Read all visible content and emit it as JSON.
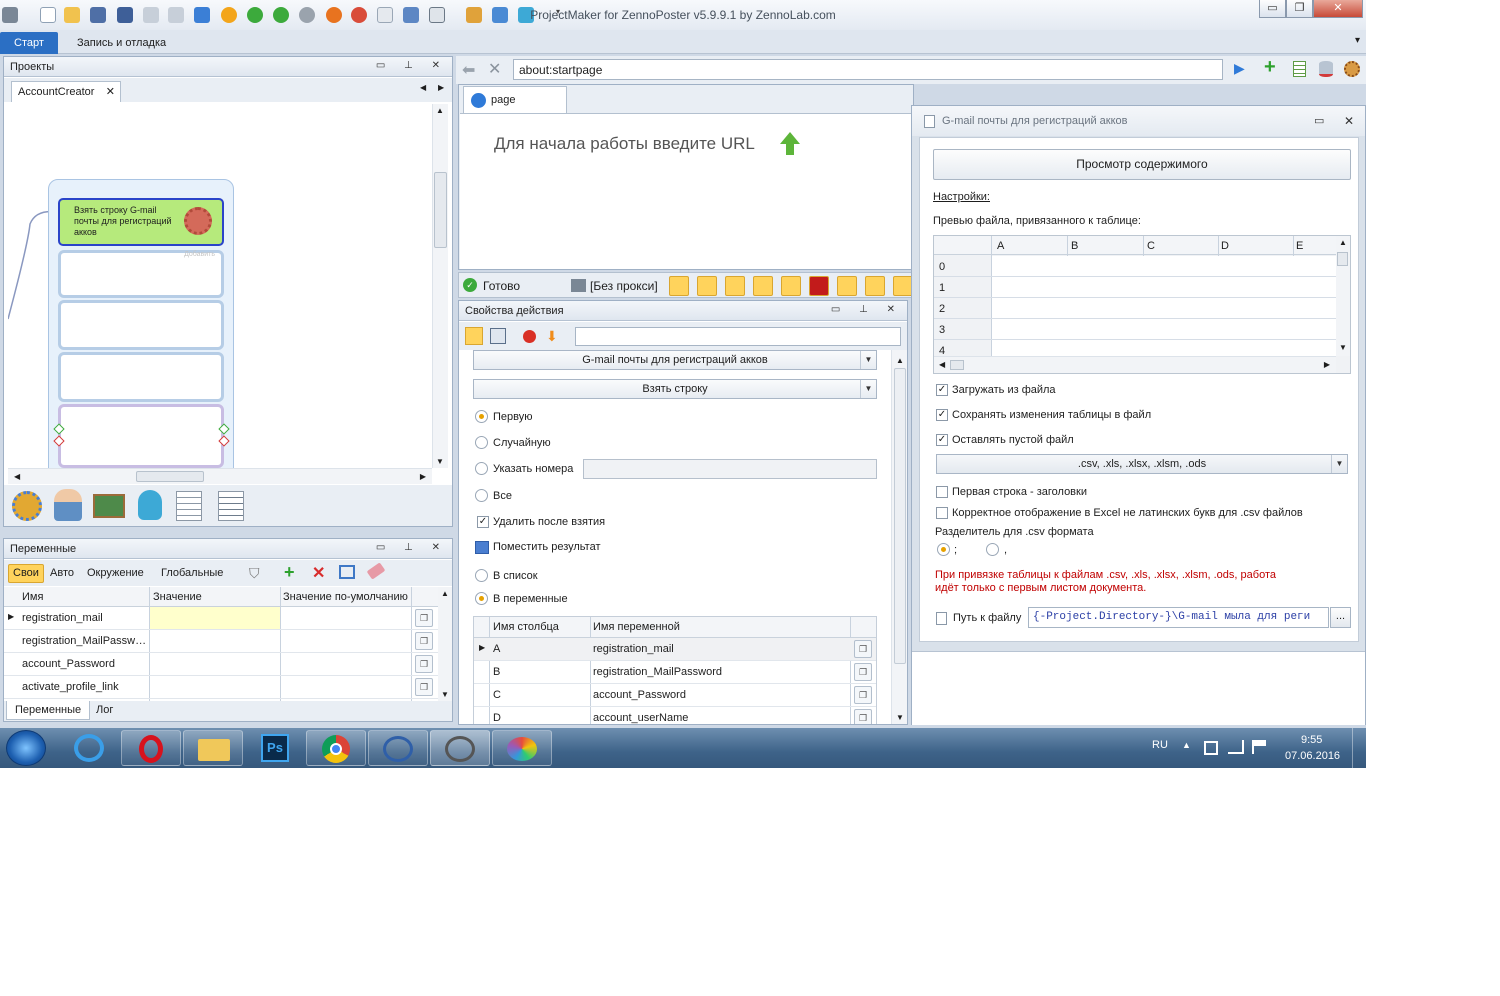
{
  "titlebar": {
    "title": "ProjectMaker for ZennoPoster v5.9.9.1 by ZennoLab.com",
    "min_icon": "minimize-icon",
    "max_icon": "maximize-icon",
    "close_icon": "close-icon"
  },
  "ribbon": {
    "tabs": [
      "Старт",
      "Запись и отладка"
    ]
  },
  "projects": {
    "title": "Проекты",
    "tab_label": "AccountCreator",
    "node_label": "Взять строку G-mail почты для регистраций акков",
    "node_small_text": "Добавить"
  },
  "browser": {
    "url": "about:startpage",
    "page_tab": "page",
    "start_hint": "Для начала работы введите URL",
    "status_ready": "Готово",
    "status_proxy": "[Без прокси]"
  },
  "props": {
    "title": "Свойства действия",
    "table_combo": "G-mail почты для регистраций акков",
    "action_combo": "Взять строку",
    "radio_first": "Первую",
    "radio_random": "Случайную",
    "radio_numbers": "Указать номера",
    "radio_all": "Все",
    "chk_delete": "Удалить после взятия",
    "put_result": "Поместить результат",
    "radio_to_list": "В список",
    "radio_to_vars": "В переменные",
    "grid_headers": [
      "Имя столбца",
      "Имя переменной"
    ],
    "grid_rows": [
      {
        "col": "A",
        "var": "registration_mail"
      },
      {
        "col": "B",
        "var": "registration_MailPassword"
      },
      {
        "col": "C",
        "var": "account_Password"
      },
      {
        "col": "D",
        "var": "account_userName"
      }
    ]
  },
  "variables": {
    "title": "Переменные",
    "filters": [
      "Свои",
      "Авто",
      "Окружение",
      "Глобальные"
    ],
    "headers": [
      "Имя",
      "Значение",
      "Значение по-умолчанию"
    ],
    "rows": [
      "registration_mail",
      "registration_MailPassw…",
      "account_Password",
      "activate_profile_link"
    ],
    "bottom_tabs": [
      "Переменные",
      "Лог"
    ]
  },
  "table_window": {
    "title": "G-mail почты для регистраций акков",
    "view_button": "Просмотр содержимого",
    "settings_link": "Настройки:",
    "preview_label": "Превью файла, привязанного к таблице:",
    "preview_cols": [
      "A",
      "B",
      "C",
      "D",
      "E"
    ],
    "preview_rows": [
      "0",
      "1",
      "2",
      "3",
      "4"
    ],
    "chk_load": "Загружать из файла",
    "chk_save": "Сохранять изменения таблицы в файл",
    "chk_empty": "Оставлять пустой файл",
    "formats": ".csv, .xls, .xlsx, .xlsm, .ods",
    "chk_header": "Первая строка - заголовки",
    "chk_excel": "Корректное отображение в Excel не латинских букв для .csv файлов",
    "separator_label": "Разделитель для .csv формата",
    "sep_semicolon": ";",
    "sep_comma": ",",
    "warning_line1": "При привязке таблицы к файлам .csv, .xls, .xlsx, .xlsm, .ods, работа",
    "warning_line2": "идёт только с первым листом документа.",
    "path_label": "Путь к файлу",
    "path_value": "{-Project.Directory-}\\G-mail мыла для реги",
    "browse": "..."
  },
  "taskbar": {
    "lang": "RU",
    "time": "9:55",
    "date": "07.06.2016"
  },
  "colors": {
    "accent": "#2b6fc4",
    "node_green": "#b6ea7c",
    "warning_red": "#c00000",
    "radio_on": "#e6a100"
  }
}
